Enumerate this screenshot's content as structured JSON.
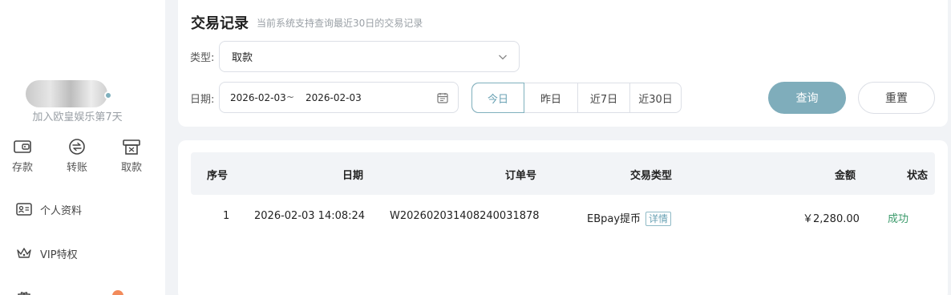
{
  "sidebar": {
    "join_text": "加入欧皇娱乐第7天",
    "quick_actions": [
      {
        "label": "存款",
        "icon": "wallet-icon"
      },
      {
        "label": "转账",
        "icon": "transfer-icon"
      },
      {
        "label": "取款",
        "icon": "withdraw-icon"
      }
    ],
    "menu": [
      {
        "label": "个人资料",
        "icon": "id-card-icon"
      },
      {
        "label": "VIP特权",
        "icon": "crown-icon"
      }
    ]
  },
  "filter": {
    "title": "交易记录",
    "subtitle": "当前系统支持查询最近30日的交易记录",
    "type_label": "类型:",
    "type_value": "取款",
    "date_label": "日期:",
    "date_from": "2026-02-03",
    "date_separator": "~",
    "date_to": "2026-02-03",
    "quick_ranges": [
      "今日",
      "昨日",
      "近7日",
      "近30日"
    ],
    "active_range": "今日",
    "query_label": "查询",
    "reset_label": "重置"
  },
  "table": {
    "columns": [
      "序号",
      "日期",
      "订单号",
      "交易类型",
      "金额",
      "状态"
    ],
    "rows": [
      {
        "index": "1",
        "date": "2026-02-03 14:08:24",
        "order_no": "W202602031408240031878",
        "type": "EBpay提币",
        "detail_label": "详情",
        "amount": "￥2,280.00",
        "status": "成功"
      }
    ]
  },
  "colors": {
    "accent": "#7fadbb",
    "success": "#3a9a6a",
    "badge": "#f28b5b"
  }
}
